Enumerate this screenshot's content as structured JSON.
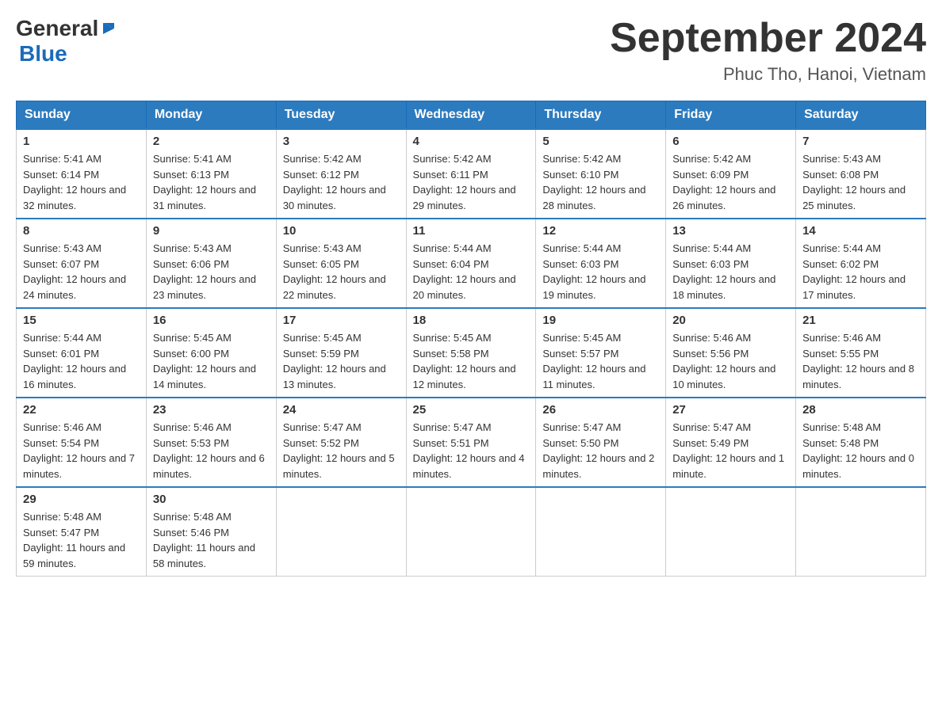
{
  "header": {
    "title": "September 2024",
    "location": "Phuc Tho, Hanoi, Vietnam",
    "logo": {
      "general": "General",
      "blue": "Blue"
    }
  },
  "weekdays": [
    "Sunday",
    "Monday",
    "Tuesday",
    "Wednesday",
    "Thursday",
    "Friday",
    "Saturday"
  ],
  "weeks": [
    [
      {
        "day": "1",
        "sunrise": "Sunrise: 5:41 AM",
        "sunset": "Sunset: 6:14 PM",
        "daylight": "Daylight: 12 hours and 32 minutes."
      },
      {
        "day": "2",
        "sunrise": "Sunrise: 5:41 AM",
        "sunset": "Sunset: 6:13 PM",
        "daylight": "Daylight: 12 hours and 31 minutes."
      },
      {
        "day": "3",
        "sunrise": "Sunrise: 5:42 AM",
        "sunset": "Sunset: 6:12 PM",
        "daylight": "Daylight: 12 hours and 30 minutes."
      },
      {
        "day": "4",
        "sunrise": "Sunrise: 5:42 AM",
        "sunset": "Sunset: 6:11 PM",
        "daylight": "Daylight: 12 hours and 29 minutes."
      },
      {
        "day": "5",
        "sunrise": "Sunrise: 5:42 AM",
        "sunset": "Sunset: 6:10 PM",
        "daylight": "Daylight: 12 hours and 28 minutes."
      },
      {
        "day": "6",
        "sunrise": "Sunrise: 5:42 AM",
        "sunset": "Sunset: 6:09 PM",
        "daylight": "Daylight: 12 hours and 26 minutes."
      },
      {
        "day": "7",
        "sunrise": "Sunrise: 5:43 AM",
        "sunset": "Sunset: 6:08 PM",
        "daylight": "Daylight: 12 hours and 25 minutes."
      }
    ],
    [
      {
        "day": "8",
        "sunrise": "Sunrise: 5:43 AM",
        "sunset": "Sunset: 6:07 PM",
        "daylight": "Daylight: 12 hours and 24 minutes."
      },
      {
        "day": "9",
        "sunrise": "Sunrise: 5:43 AM",
        "sunset": "Sunset: 6:06 PM",
        "daylight": "Daylight: 12 hours and 23 minutes."
      },
      {
        "day": "10",
        "sunrise": "Sunrise: 5:43 AM",
        "sunset": "Sunset: 6:05 PM",
        "daylight": "Daylight: 12 hours and 22 minutes."
      },
      {
        "day": "11",
        "sunrise": "Sunrise: 5:44 AM",
        "sunset": "Sunset: 6:04 PM",
        "daylight": "Daylight: 12 hours and 20 minutes."
      },
      {
        "day": "12",
        "sunrise": "Sunrise: 5:44 AM",
        "sunset": "Sunset: 6:03 PM",
        "daylight": "Daylight: 12 hours and 19 minutes."
      },
      {
        "day": "13",
        "sunrise": "Sunrise: 5:44 AM",
        "sunset": "Sunset: 6:03 PM",
        "daylight": "Daylight: 12 hours and 18 minutes."
      },
      {
        "day": "14",
        "sunrise": "Sunrise: 5:44 AM",
        "sunset": "Sunset: 6:02 PM",
        "daylight": "Daylight: 12 hours and 17 minutes."
      }
    ],
    [
      {
        "day": "15",
        "sunrise": "Sunrise: 5:44 AM",
        "sunset": "Sunset: 6:01 PM",
        "daylight": "Daylight: 12 hours and 16 minutes."
      },
      {
        "day": "16",
        "sunrise": "Sunrise: 5:45 AM",
        "sunset": "Sunset: 6:00 PM",
        "daylight": "Daylight: 12 hours and 14 minutes."
      },
      {
        "day": "17",
        "sunrise": "Sunrise: 5:45 AM",
        "sunset": "Sunset: 5:59 PM",
        "daylight": "Daylight: 12 hours and 13 minutes."
      },
      {
        "day": "18",
        "sunrise": "Sunrise: 5:45 AM",
        "sunset": "Sunset: 5:58 PM",
        "daylight": "Daylight: 12 hours and 12 minutes."
      },
      {
        "day": "19",
        "sunrise": "Sunrise: 5:45 AM",
        "sunset": "Sunset: 5:57 PM",
        "daylight": "Daylight: 12 hours and 11 minutes."
      },
      {
        "day": "20",
        "sunrise": "Sunrise: 5:46 AM",
        "sunset": "Sunset: 5:56 PM",
        "daylight": "Daylight: 12 hours and 10 minutes."
      },
      {
        "day": "21",
        "sunrise": "Sunrise: 5:46 AM",
        "sunset": "Sunset: 5:55 PM",
        "daylight": "Daylight: 12 hours and 8 minutes."
      }
    ],
    [
      {
        "day": "22",
        "sunrise": "Sunrise: 5:46 AM",
        "sunset": "Sunset: 5:54 PM",
        "daylight": "Daylight: 12 hours and 7 minutes."
      },
      {
        "day": "23",
        "sunrise": "Sunrise: 5:46 AM",
        "sunset": "Sunset: 5:53 PM",
        "daylight": "Daylight: 12 hours and 6 minutes."
      },
      {
        "day": "24",
        "sunrise": "Sunrise: 5:47 AM",
        "sunset": "Sunset: 5:52 PM",
        "daylight": "Daylight: 12 hours and 5 minutes."
      },
      {
        "day": "25",
        "sunrise": "Sunrise: 5:47 AM",
        "sunset": "Sunset: 5:51 PM",
        "daylight": "Daylight: 12 hours and 4 minutes."
      },
      {
        "day": "26",
        "sunrise": "Sunrise: 5:47 AM",
        "sunset": "Sunset: 5:50 PM",
        "daylight": "Daylight: 12 hours and 2 minutes."
      },
      {
        "day": "27",
        "sunrise": "Sunrise: 5:47 AM",
        "sunset": "Sunset: 5:49 PM",
        "daylight": "Daylight: 12 hours and 1 minute."
      },
      {
        "day": "28",
        "sunrise": "Sunrise: 5:48 AM",
        "sunset": "Sunset: 5:48 PM",
        "daylight": "Daylight: 12 hours and 0 minutes."
      }
    ],
    [
      {
        "day": "29",
        "sunrise": "Sunrise: 5:48 AM",
        "sunset": "Sunset: 5:47 PM",
        "daylight": "Daylight: 11 hours and 59 minutes."
      },
      {
        "day": "30",
        "sunrise": "Sunrise: 5:48 AM",
        "sunset": "Sunset: 5:46 PM",
        "daylight": "Daylight: 11 hours and 58 minutes."
      },
      {
        "day": "",
        "sunrise": "",
        "sunset": "",
        "daylight": ""
      },
      {
        "day": "",
        "sunrise": "",
        "sunset": "",
        "daylight": ""
      },
      {
        "day": "",
        "sunrise": "",
        "sunset": "",
        "daylight": ""
      },
      {
        "day": "",
        "sunrise": "",
        "sunset": "",
        "daylight": ""
      },
      {
        "day": "",
        "sunrise": "",
        "sunset": "",
        "daylight": ""
      }
    ]
  ]
}
